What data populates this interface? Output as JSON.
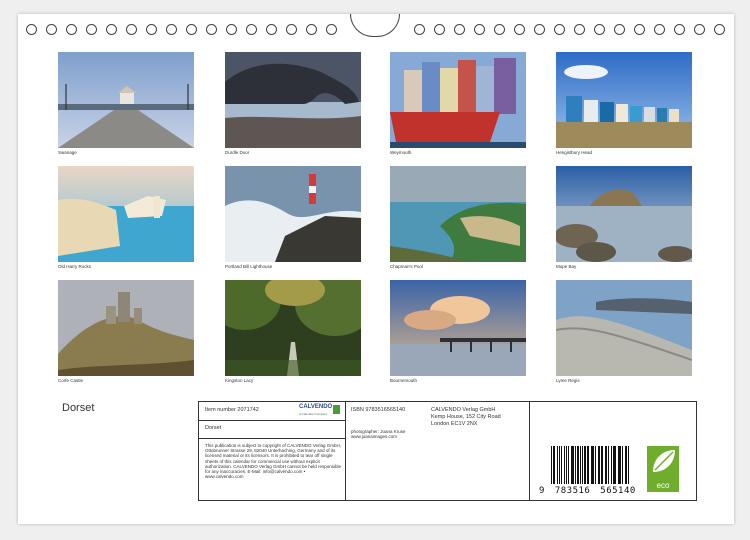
{
  "photos": [
    {
      "caption": "Swanage"
    },
    {
      "caption": "Durdle Door"
    },
    {
      "caption": "Weymouth"
    },
    {
      "caption": "Hengistbury Head"
    },
    {
      "caption": "Old Harry Rocks"
    },
    {
      "caption": "Portland Bill Lighthouse"
    },
    {
      "caption": "Chapman's Pool"
    },
    {
      "caption": "Mupe Bay"
    },
    {
      "caption": "Corfe Castle"
    },
    {
      "caption": "Kingston Lacy"
    },
    {
      "caption": "Bournemouth"
    },
    {
      "caption": "Lyme Regis"
    }
  ],
  "title": "Dorset",
  "info": {
    "item_number": "Item number 2071742",
    "brand": "CALVENDO",
    "brand_sub": "A Calendar Company",
    "name": "Dorset",
    "legal": "This publication is subject to copyright of CALVENDO Verlag GmbH, Ottobrunner Strasse 29, 82040 Unterhaching, Germany and of its licensed material or its licensors. It is prohibited to tear off single sheets of this calendar for commercial use without explicit authorization. CALVENDO Verlag GmbH cannot be held responsible for any inaccuracies. E-Mail: info@calvendo.com • www.calvendo.com",
    "isbn": "ISBN 9783516565140",
    "photographer": "photographer: Joana Kruse",
    "website": "www.joanaimages.com",
    "publisher_1": "CALVENDO Verlag GmbH",
    "publisher_2": "Kemp House, 152 City Road",
    "publisher_3": "London EC1V 2NX",
    "barcode_first": "9",
    "barcode_left": "783516",
    "barcode_right": "565140",
    "eco_label": "eco"
  }
}
